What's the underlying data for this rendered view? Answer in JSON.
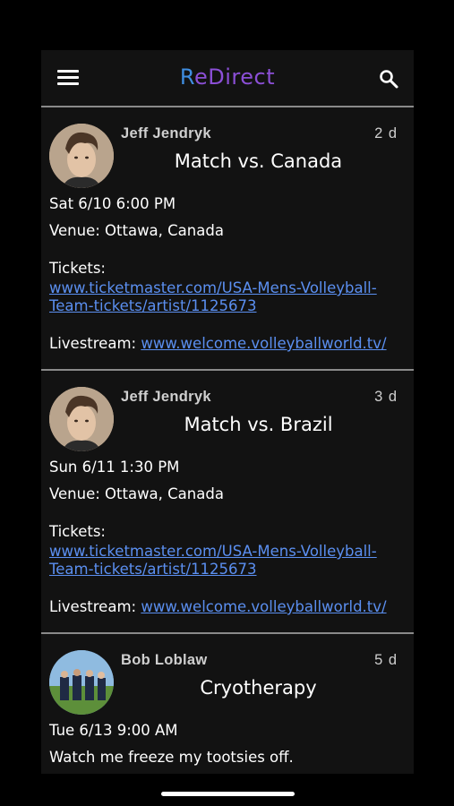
{
  "app": {
    "logo_r": "R",
    "logo_rest": "eDirect"
  },
  "posts": [
    {
      "author": "Jeff Jendryk",
      "age": "2 d",
      "title": "Match vs. Canada",
      "datetime": "Sat  6/10 6:00 PM",
      "venue": "Venue: Ottawa, Canada",
      "tickets_label": "Tickets:",
      "tickets_url_line1": "www.ticketmaster.com/USA-Mens-Volleyball-",
      "tickets_url_line2": "Team-tickets/artist/1125673",
      "livestream_label": "Livestream:",
      "livestream_url": "www.welcome.volleyballworld.tv/"
    },
    {
      "author": "Jeff Jendryk",
      "age": "3 d",
      "title": "Match vs. Brazil",
      "datetime": "Sun  6/11 1:30 PM",
      "venue": "Venue: Ottawa, Canada",
      "tickets_label": "Tickets:",
      "tickets_url_line1": "www.ticketmaster.com/USA-Mens-Volleyball-",
      "tickets_url_line2": "Team-tickets/artist/1125673",
      "livestream_label": "Livestream:",
      "livestream_url": "www.welcome.volleyballworld.tv/"
    },
    {
      "author": "Bob Loblaw",
      "age": "5 d",
      "title": "Cryotherapy",
      "datetime": "Tue  6/13 9:00 AM",
      "body": "Watch me freeze my tootsies off."
    }
  ],
  "colors": {
    "background": "#121212",
    "link": "#5b8ff0",
    "logo_blue": "#3f8de0",
    "logo_purple": "#8b4fd6",
    "divider": "#8a8a8a"
  }
}
